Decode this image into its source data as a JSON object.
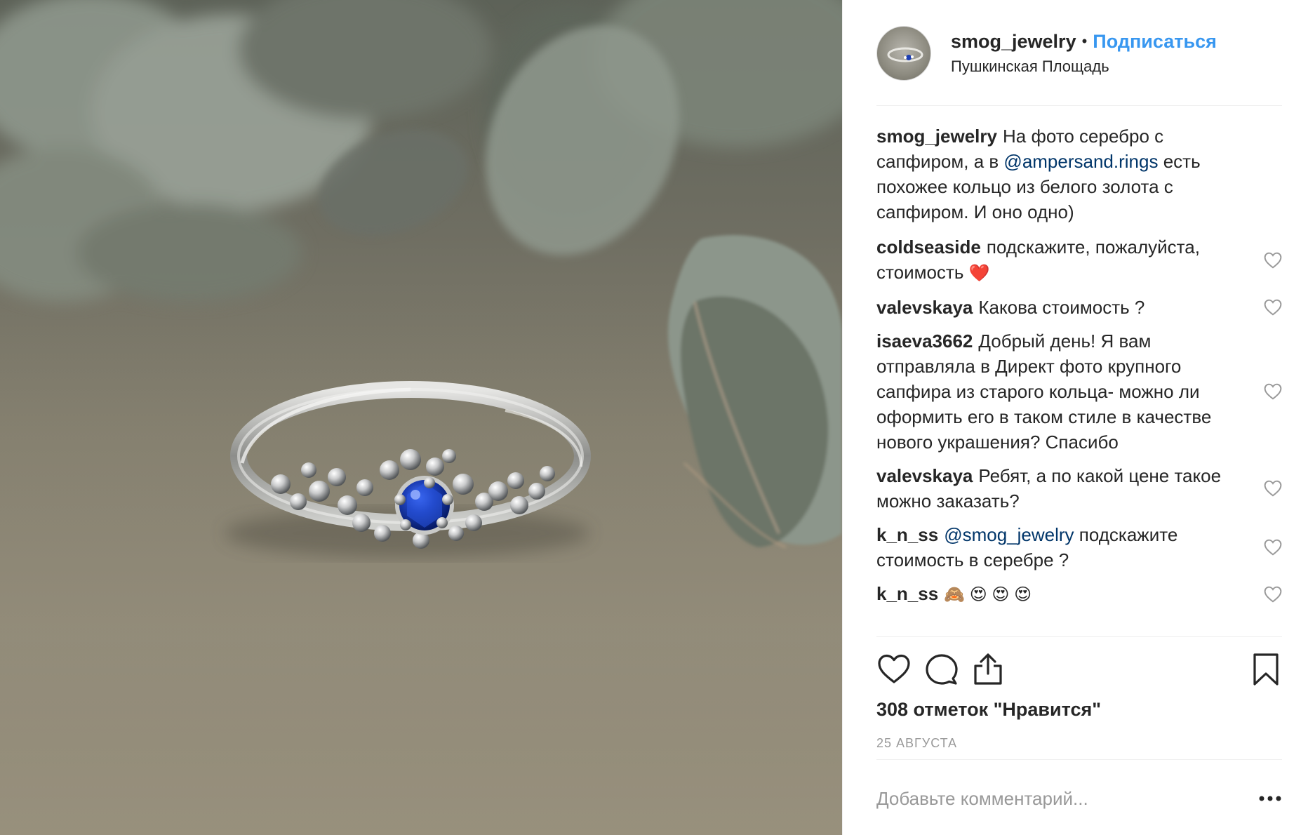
{
  "header": {
    "username": "smog_jewelry",
    "separator": "•",
    "follow_label": "Подписаться",
    "location": "Пушкинская Площадь"
  },
  "caption": {
    "username": "smog_jewelry",
    "text_before": "На фото серебро с сапфиром, а в ",
    "mention": "@ampersand.rings",
    "text_after": " есть похожее кольцо из белого золота с сапфиром. И оно одно)"
  },
  "comments": [
    {
      "username": "coldseaside",
      "text": "подскажите, пожалуйста, стоимость",
      "emoji": "❤️"
    },
    {
      "username": "valevskaya",
      "text": "Какова стоимость ?"
    },
    {
      "username": "isaeva3662",
      "text": "Добрый день! Я вам отправляла в Директ фото крупного сапфира из старого кольца- можно ли оформить его в таком стиле в качестве нового украшения? Спасибо"
    },
    {
      "username": "valevskaya",
      "text": "Ребят, а по какой цене такое можно заказать?"
    },
    {
      "username": "k_n_ss",
      "mention": "@smog_jewelry",
      "text": " подскажите стоимость в серебре ?"
    },
    {
      "username": "k_n_ss",
      "text": "🙈 😍 😍 😍"
    }
  ],
  "likes_text": "308 отметок \"Нравится\"",
  "date_text": "25 АВГУСТА",
  "add_comment_placeholder": "Добавьте комментарий...",
  "icons": {
    "like": "heart-icon",
    "comment": "comment-bubble-icon",
    "share": "share-icon",
    "save": "bookmark-icon",
    "more": "more-options-icon"
  },
  "colors": {
    "link": "#3897f0",
    "mention": "#003569",
    "muted": "#999999",
    "text": "#262626",
    "divider": "#efefef"
  }
}
